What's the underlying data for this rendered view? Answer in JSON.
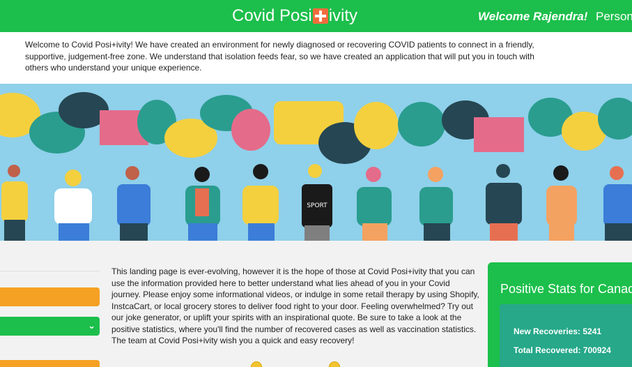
{
  "header": {
    "brand_left": "Covid Posi",
    "brand_right": "ivity",
    "welcome": "Welcome Rajendra!",
    "nav_personal": "Person"
  },
  "intro": "Welcome to Covid Posi+ivity! We have created an environment for newly diagnosed or recovering COVID patients to connect in a friendly, supportive, judgement-free zone. We understand that isolation feeds fear, so we have created an application that will put you in touch with others who understand your unique experience.",
  "banner": {
    "shirt_text": "SPORT",
    "colors": {
      "sky": "#8fd0ea",
      "teal": "#2a9d8f",
      "dark": "#264653",
      "yellow": "#f4d03f",
      "pink": "#e56b8a",
      "orange": "#f4a261"
    }
  },
  "main": {
    "landing_text": "This landing page is ever-evolving, however it is the hope of those at Covid Posi+ivity that you can use the information provided here to better understand what lies ahead of you in your Covid journey. Please enjoy some informational videos, or indulge in some retail therapy by using Shopify, InstcaCart, or local grocery stores to deliver food right to your door. Feeling overwhelmed? Try out our joke generator, or uplift your spirits with an inspirational quote. Be sure to take a look at the positive statistics, where you'll find the number of recovered cases as well as vaccination statistics. The team at Covid Posi+ivity wish you a quick and easy recovery!"
  },
  "stats": {
    "title": "Positive Stats for Canad",
    "new_recoveries": "New Recoveries: 5241",
    "total_recovered": "Total Recovered: 700924"
  },
  "colors": {
    "green": "#1cbf4b",
    "orange": "#f5a123",
    "stats_inner": "#26a889"
  }
}
